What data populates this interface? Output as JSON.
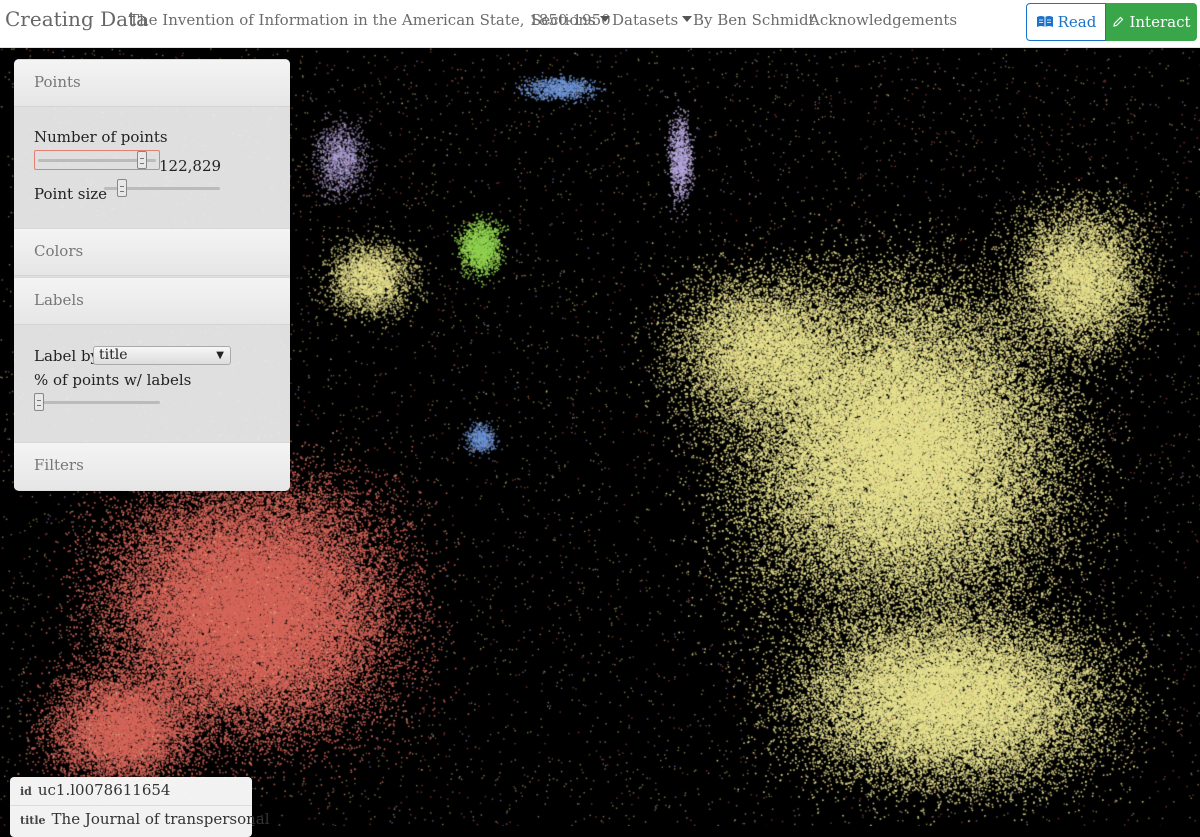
{
  "navbar": {
    "brand": "Creating Data",
    "subtitle": "The Invention of Information in the American State, 1850-1950",
    "sections": "Sections",
    "datasets": "Datasets",
    "author": "By Ben Schmidt",
    "acknowledgements": "Acknowledgements",
    "read": "Read",
    "interact": "Interact",
    "read_icon": "open-book-icon",
    "interact_icon": "pencil-icon"
  },
  "panel": {
    "points": {
      "title": "Points",
      "number_label": "Number of points",
      "number_value": "122,829",
      "number_fraction": 0.88,
      "size_label": "Point size",
      "size_fraction": 0.12
    },
    "colors": {
      "title": "Colors"
    },
    "labels": {
      "title": "Labels",
      "label_by": "Label by:",
      "label_by_value": "title",
      "pct_label": "% of points w/ labels",
      "pct_fraction": 0.0
    },
    "filters": {
      "title": "Filters"
    }
  },
  "tooltip": {
    "id_key": "id",
    "id_value": "uc1.l0078611654",
    "title_key": "title",
    "title_value": "The Journal of transpersonal"
  },
  "colors": {
    "background": "#000000",
    "yellow": "#e8e28f",
    "salmon": "#d7665a",
    "green": "#8fd14f",
    "blue": "#6f96d8",
    "lavender": "#b7a8df",
    "read_blue": "#1a73c8",
    "interact_green": "#3aa64a"
  }
}
